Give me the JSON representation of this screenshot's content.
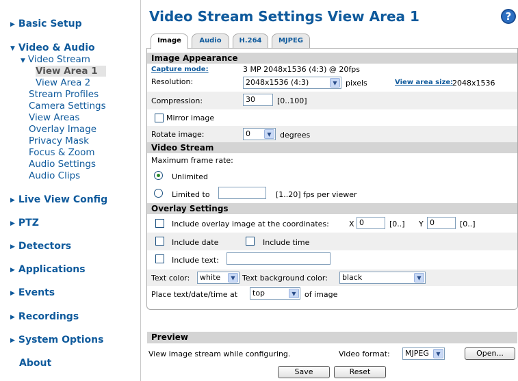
{
  "title": "Video Stream Settings View Area 1",
  "help_symbol": "?",
  "sidebar": {
    "basic_setup": "Basic Setup",
    "video_audio": "Video & Audio",
    "video_stream": "Video Stream",
    "view_area_1": "View Area 1",
    "view_area_2": "View Area 2",
    "sub_items": [
      "Stream Profiles",
      "Camera Settings",
      "View Areas",
      "Overlay Image",
      "Privacy Mask",
      "Focus & Zoom",
      "Audio Settings",
      "Audio Clips"
    ],
    "live_view_config": "Live View Config",
    "ptz": "PTZ",
    "detectors": "Detectors",
    "applications": "Applications",
    "events": "Events",
    "recordings": "Recordings",
    "system_options": "System Options",
    "about": "About"
  },
  "tabs": [
    "Image",
    "Audio",
    "H.264",
    "MJPEG"
  ],
  "image_appearance": {
    "heading": "Image Appearance",
    "capture_mode_label": "Capture mode:",
    "capture_mode_value": "3 MP 2048x1536 (4:3) @ 20fps",
    "resolution_label": "Resolution:",
    "resolution_value": "2048x1536 (4:3)",
    "pixels": "pixels",
    "view_area_size_label": "View area size:",
    "view_area_size_value": "2048x1536",
    "compression_label": "Compression:",
    "compression_value": "30",
    "compression_range": "[0..100]",
    "mirror_label": "Mirror image",
    "rotate_label": "Rotate image:",
    "rotate_value": "0",
    "degrees": "degrees"
  },
  "video_stream": {
    "heading": "Video Stream",
    "max_frame_rate": "Maximum frame rate:",
    "unlimited": "Unlimited",
    "limited_to": "Limited to",
    "limited_value": "",
    "fps_range": "[1..20] fps per viewer"
  },
  "overlay": {
    "heading": "Overlay Settings",
    "include_overlay_image": "Include overlay image at the coordinates:",
    "x_label": "X",
    "x_value": "0",
    "x_range": "[0..]",
    "y_label": "Y",
    "y_value": "0",
    "y_range": "[0..]",
    "include_date": "Include date",
    "include_time": "Include time",
    "include_text": "Include text:",
    "text_value": "",
    "text_color_label": "Text color:",
    "text_color_value": "white",
    "text_bg_label": "Text background color:",
    "text_bg_value": "black",
    "place_label": "Place text/date/time at",
    "place_value": "top",
    "of_image": "of image"
  },
  "preview": {
    "heading": "Preview",
    "description": "View image stream while configuring.",
    "video_format_label": "Video format:",
    "video_format_value": "MJPEG",
    "open_button": "Open..."
  },
  "buttons": {
    "save": "Save",
    "reset": "Reset"
  },
  "colors": {
    "link_blue": "#0f5a9c",
    "section_grey": "#d4d4d4",
    "row_shade": "#efefef"
  }
}
